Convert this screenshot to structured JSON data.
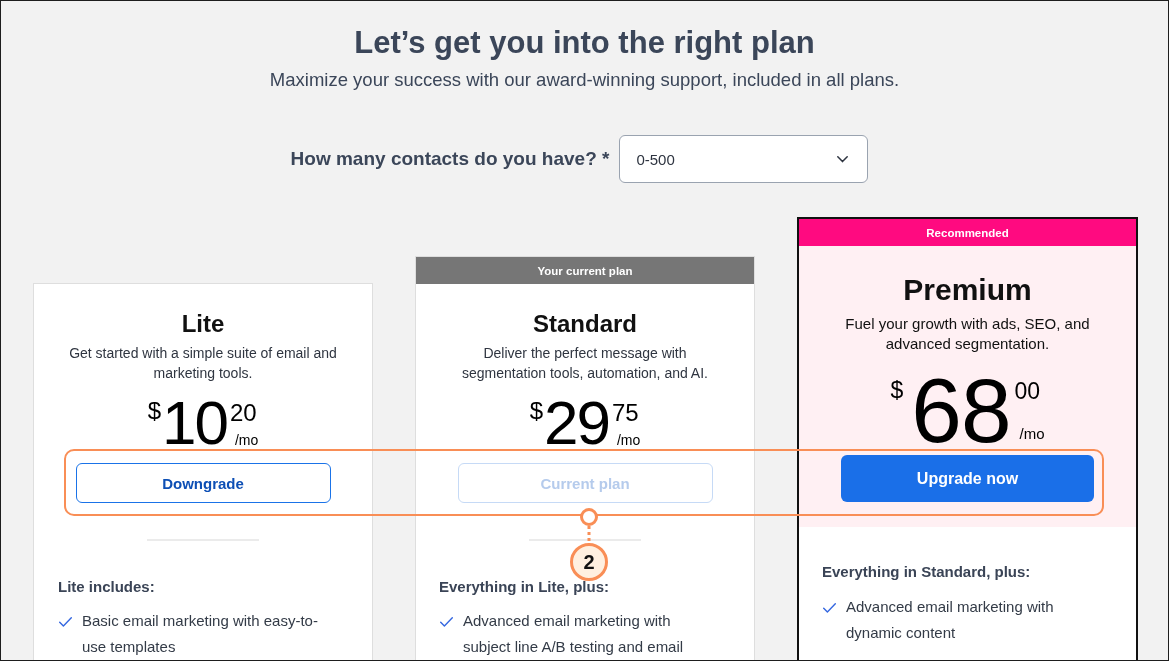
{
  "header": {
    "title": "Let’s get you into the right plan",
    "subtitle": "Maximize your success with our award-winning support, included in all plans."
  },
  "contacts": {
    "label": "How many contacts do you have? *",
    "value": "0-500"
  },
  "plans": [
    {
      "name": "Lite",
      "description": "Get started with a simple suite of email and marketing tools.",
      "price": {
        "currency": "$",
        "whole": "10",
        "cents": "20",
        "period": "/mo"
      },
      "button": {
        "label": "Downgrade",
        "kind": "outline",
        "disabled": false
      },
      "features_heading": "Lite includes:",
      "features": [
        "Basic email marketing with easy-to-use templates"
      ]
    },
    {
      "name": "Standard",
      "banner": {
        "kind": "current",
        "text": "Your current plan"
      },
      "description": "Deliver the perfect message with segmentation tools, automation, and AI.",
      "price": {
        "currency": "$",
        "whole": "29",
        "cents": "75",
        "period": "/mo"
      },
      "button": {
        "label": "Current plan",
        "kind": "outline",
        "disabled": true
      },
      "features_heading": "Everything in Lite, plus:",
      "features": [
        "Advanced email marketing with subject line A/B testing and email"
      ]
    },
    {
      "name": "Premium",
      "banner": {
        "kind": "recommended",
        "text": "Recommended"
      },
      "description": "Fuel your growth with ads, SEO, and advanced segmentation.",
      "price": {
        "currency": "$",
        "whole": "68",
        "cents": "00",
        "period": "/mo"
      },
      "button": {
        "label": "Upgrade now",
        "kind": "primary",
        "disabled": false
      },
      "features_heading": "Everything in Standard, plus:",
      "features": [
        "Advanced email marketing with dynamic content"
      ]
    }
  ],
  "annotation": {
    "number": "2"
  }
}
